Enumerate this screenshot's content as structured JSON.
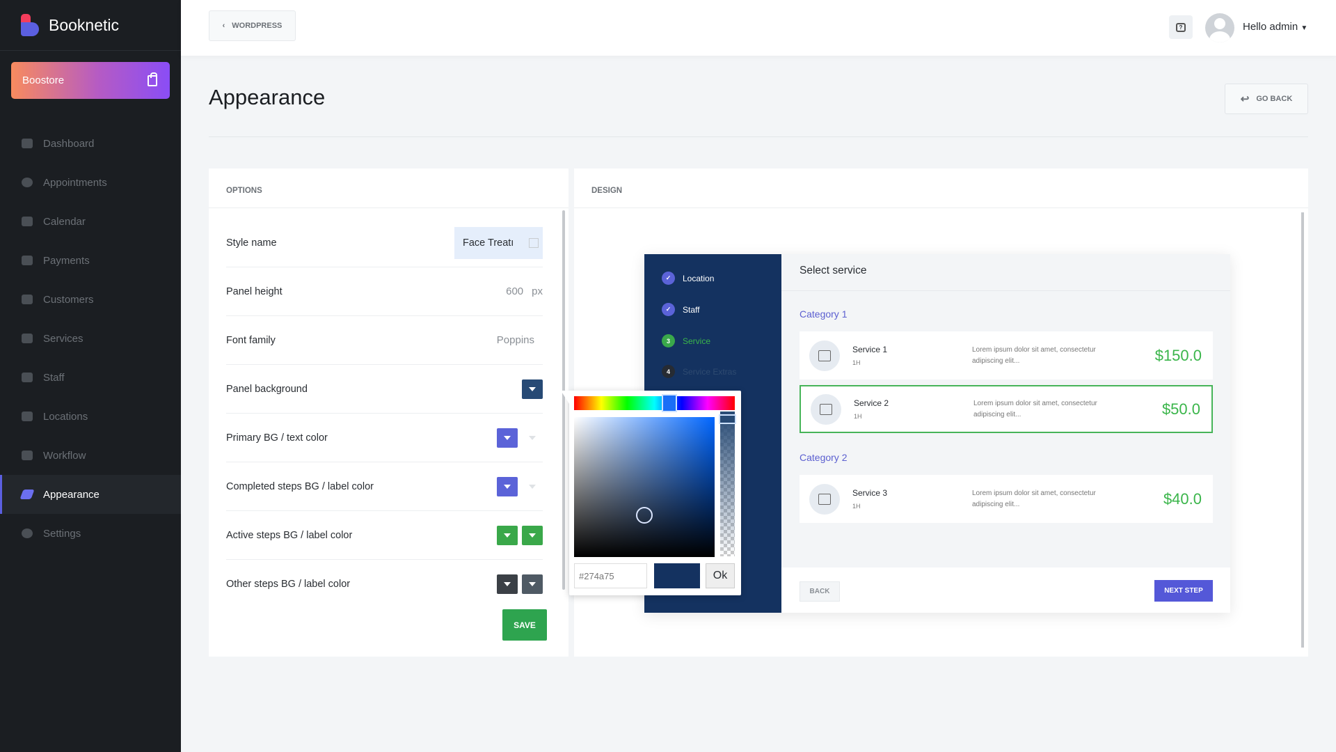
{
  "app": {
    "name": "Booknetic",
    "boostore": "Boostore"
  },
  "sidebar": {
    "items": [
      {
        "label": "Dashboard",
        "icon": "dashboard-icon"
      },
      {
        "label": "Appointments",
        "icon": "clock-icon"
      },
      {
        "label": "Calendar",
        "icon": "calendar-icon"
      },
      {
        "label": "Payments",
        "icon": "wallet-icon"
      },
      {
        "label": "Customers",
        "icon": "users-icon"
      },
      {
        "label": "Services",
        "icon": "list-icon"
      },
      {
        "label": "Staff",
        "icon": "user-icon"
      },
      {
        "label": "Locations",
        "icon": "location-arrow-icon"
      },
      {
        "label": "Workflow",
        "icon": "workflow-icon"
      },
      {
        "label": "Appearance",
        "icon": "brush-icon",
        "active": true
      },
      {
        "label": "Settings",
        "icon": "gear-icon"
      }
    ]
  },
  "header": {
    "wordpress": "WORDPRESS",
    "user": "Hello admin"
  },
  "page": {
    "title": "Appearance",
    "go_back": "GO BACK"
  },
  "options": {
    "title": "OPTIONS",
    "style_name_label": "Style name",
    "style_name_value": "Face Treatı",
    "panel_height_label": "Panel height",
    "panel_height_value": "600",
    "panel_height_unit": "px",
    "font_family_label": "Font family",
    "font_family_value": "Poppins",
    "panel_bg_label": "Panel background",
    "primary_label": "Primary BG / text color",
    "completed_label": "Completed steps BG / label color",
    "active_label": "Active steps BG / label color",
    "other_label": "Other steps BG / label color",
    "save": "SAVE",
    "colors": {
      "panel_bg": "#274a75",
      "primary": "#5b63d8",
      "active": "#3aa84a",
      "other": "#3b4046",
      "other2": "#4f5a64"
    }
  },
  "design": {
    "title": "DESIGN",
    "steps": [
      {
        "label": "Location",
        "mark": "✓"
      },
      {
        "label": "Staff",
        "mark": "✓"
      },
      {
        "label": "Service",
        "mark": "3"
      },
      {
        "label": "Service Extras",
        "mark": "4"
      }
    ],
    "heading": "Select service",
    "categories": [
      "Category 1",
      "Category 2"
    ],
    "services": [
      {
        "name": "Service 1",
        "duration": "1H",
        "desc": "Lorem ipsum dolor sit amet, consectetur adipiscing elit...",
        "price": "$150.0"
      },
      {
        "name": "Service 2",
        "duration": "1H",
        "desc": "Lorem ipsum dolor sit amet, consectetur adipiscing elit...",
        "price": "$50.0",
        "selected": true
      },
      {
        "name": "Service 3",
        "duration": "1H",
        "desc": "Lorem ipsum dolor sit amet, consectetur adipiscing elit...",
        "price": "$40.0"
      }
    ],
    "back": "BACK",
    "next": "NEXT STEP"
  },
  "picker": {
    "hex": "#274a75",
    "ok": "Ok"
  }
}
